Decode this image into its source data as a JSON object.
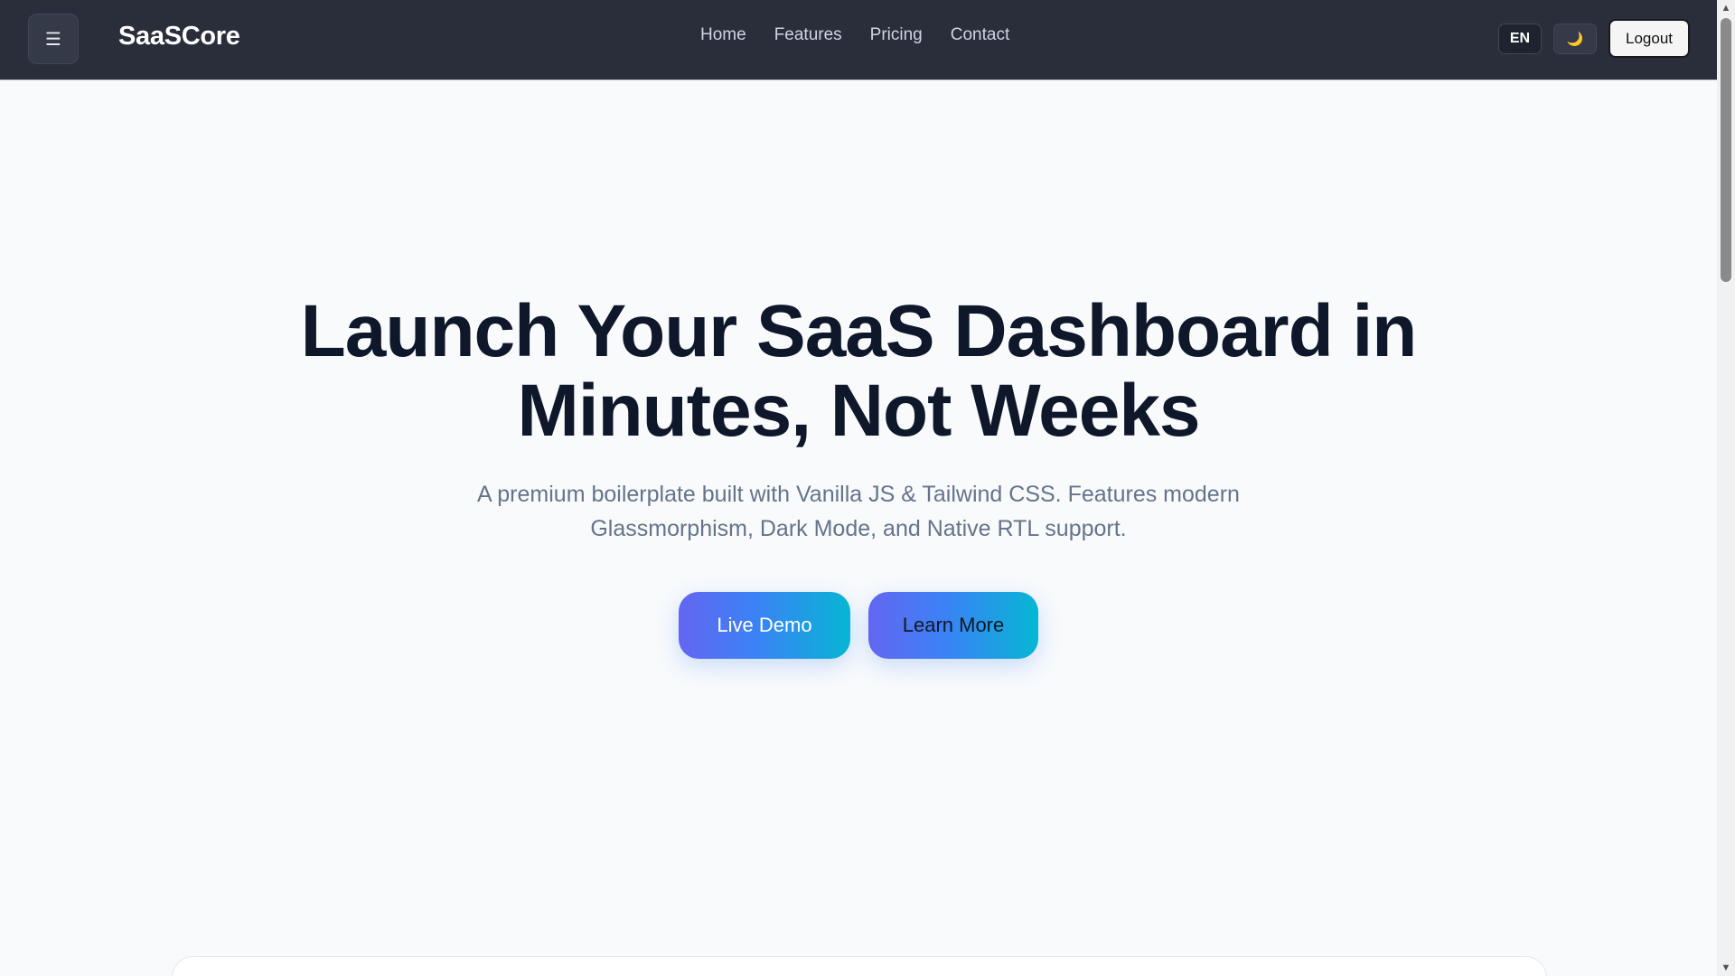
{
  "navbar": {
    "menu_icon": "☰",
    "brand": "SaaSCore",
    "links": [
      "Home",
      "Features",
      "Pricing",
      "Contact"
    ],
    "lang": "EN",
    "theme_icon": "🌙",
    "logout": "Logout"
  },
  "hero": {
    "title_line1": "Launch Your SaaS Dashboard in",
    "title_line2": "Minutes, Not Weeks",
    "subtitle_line1": "A premium boilerplate built with Vanilla JS & Tailwind CSS. Features modern",
    "subtitle_line2": "Glassmorphism, Dark Mode, and Native RTL support.",
    "primary_button": "Live Demo",
    "secondary_button": "Learn More"
  },
  "scrollbar": {
    "up_arrow": "▲",
    "down_arrow": "▼"
  },
  "colors": {
    "navbar_bg": "#2a2e3b",
    "page_bg": "#f8fafc",
    "title": "#0f172a",
    "subtitle": "#64748b",
    "gradient_start": "#6366f1",
    "gradient_end": "#06b6d4"
  }
}
